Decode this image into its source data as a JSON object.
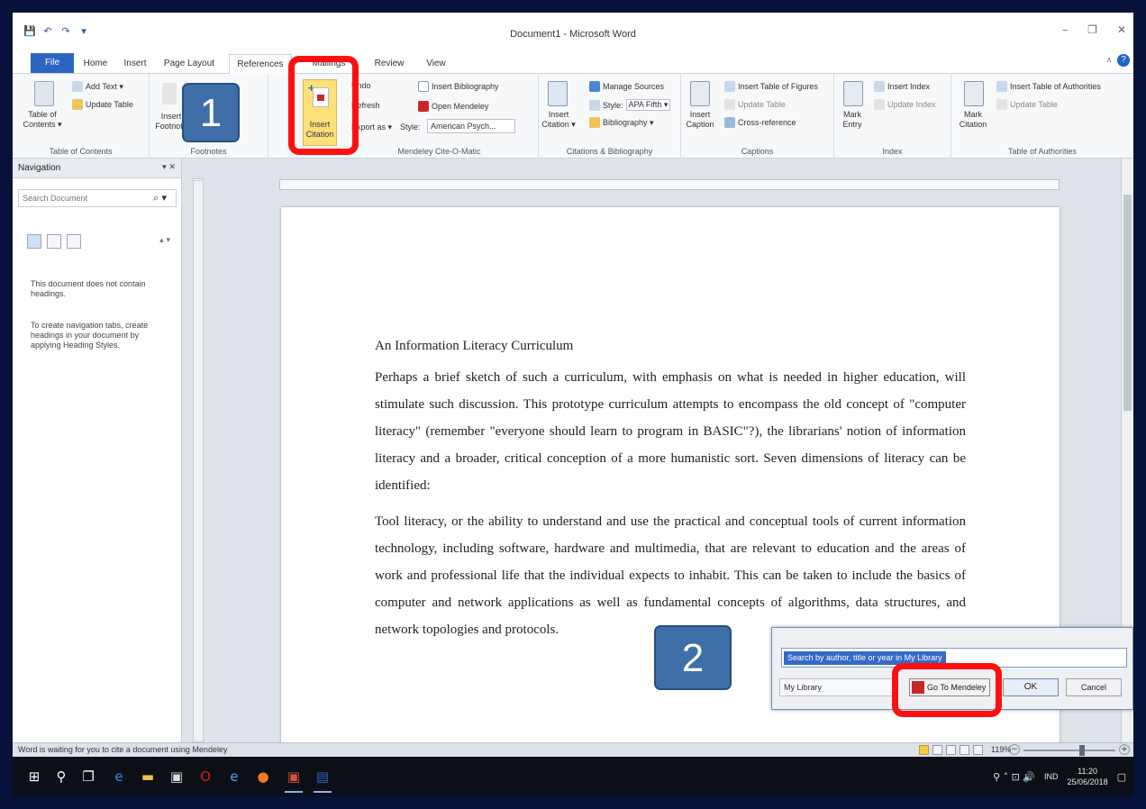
{
  "window": {
    "title": "Document1 - Microsoft Word",
    "controls": [
      "–",
      "❐",
      "✕"
    ]
  },
  "qat": [
    "💾",
    "↶",
    "↷",
    "▾"
  ],
  "tabs": [
    {
      "label": "File"
    },
    {
      "label": "Home"
    },
    {
      "label": "Insert"
    },
    {
      "label": "Page Layout"
    },
    {
      "label": "References"
    },
    {
      "label": "Mailings"
    },
    {
      "label": "Review"
    },
    {
      "label": "View"
    }
  ],
  "ribbon": {
    "toc": {
      "table_of_contents": "Table of Contents ▾",
      "add_text": "Add Text ▾",
      "update_table": "Update Table",
      "group": "Table of Contents"
    },
    "footnotes": {
      "insert": "Insert Footnote",
      "group": "Footnotes"
    },
    "mendeley": {
      "insert_citation": "Insert Citation",
      "undo": "Undo",
      "refresh": "Refresh",
      "export": "Export as ▾",
      "style_label": "Style:",
      "style_value": "American Psych...",
      "insert_bibliography": "Insert Bibliography",
      "open_mendeley": "Open Mendeley",
      "group": "Mendeley Cite-O-Matic"
    },
    "citations": {
      "insert_citation": "Insert Citation ▾",
      "manage_sources": "Manage Sources",
      "style_label": "Style:",
      "style_value": "APA Fifth ▾",
      "bibliography": "Bibliography ▾",
      "group": "Citations & Bibliography"
    },
    "captions": {
      "insert_caption": "Insert Caption",
      "insert_table_of_figures": "Insert Table of Figures",
      "update_table": "Update Table",
      "cross_reference": "Cross-reference",
      "group": "Captions"
    },
    "index": {
      "mark_entry": "Mark Entry",
      "insert_index": "Insert Index",
      "update_index": "Update Index",
      "group": "Index"
    },
    "authorities": {
      "mark_citation": "Mark Citation",
      "insert_table": "Insert Table of Authorities",
      "update_table": "Update Table",
      "group": "Table of Authorities"
    }
  },
  "annotations": {
    "step1": "1",
    "step2": "2"
  },
  "navigation": {
    "title": "Navigation",
    "controls": "▾ ✕",
    "search_placeholder": "Search Document",
    "search_icon": "⌕ ▾",
    "arrows": "▴ ▾",
    "msg1": "This document does not contain headings.",
    "msg2": "To create navigation tabs, create headings in your document by applying Heading Styles."
  },
  "document": {
    "heading": "An Information Literacy Curriculum",
    "para1": "Perhaps a brief sketch of such a curriculum, with emphasis on what is needed in higher education, will stimulate such discussion. This prototype curriculum attempts to encompass the old concept of \"computer literacy\" (remember \"everyone should learn to program in BASIC\"?), the librarians' notion of information literacy and a broader, critical conception of a more humanistic sort. Seven dimensions of literacy can be identified:",
    "para2": "Tool literacy, or the ability to understand and use the practical and conceptual tools of current information technology, including software, hardware and multimedia, that are relevant to education and the areas of work and professional life that the individual expects to inhabit. This can be taken to include the basics of computer and network applications as well as fundamental concepts of algorithms, data structures, and network topologies and protocols."
  },
  "mendeley_dialog": {
    "search_text": "Search by author, title or year in My Library",
    "library": "My Library",
    "go_to_mendeley": "Go To Mendeley",
    "ok": "OK",
    "cancel": "Cancel"
  },
  "status": {
    "text": "Word is waiting for you to cite a document using Mendeley",
    "zoom": "119%",
    "minus": "−",
    "plus": "+"
  },
  "taskbar": {
    "lang": "IND",
    "time": "11:20",
    "date": "25/06/2018",
    "tray_icons": "⚲ ˄ ⊡ 🔊"
  },
  "colors": {
    "annotation_badge": "#3e6fa8",
    "highlight": "#ff1010",
    "file_tab": "#2b66c2",
    "insert_citation_bg": "#fde07a"
  }
}
